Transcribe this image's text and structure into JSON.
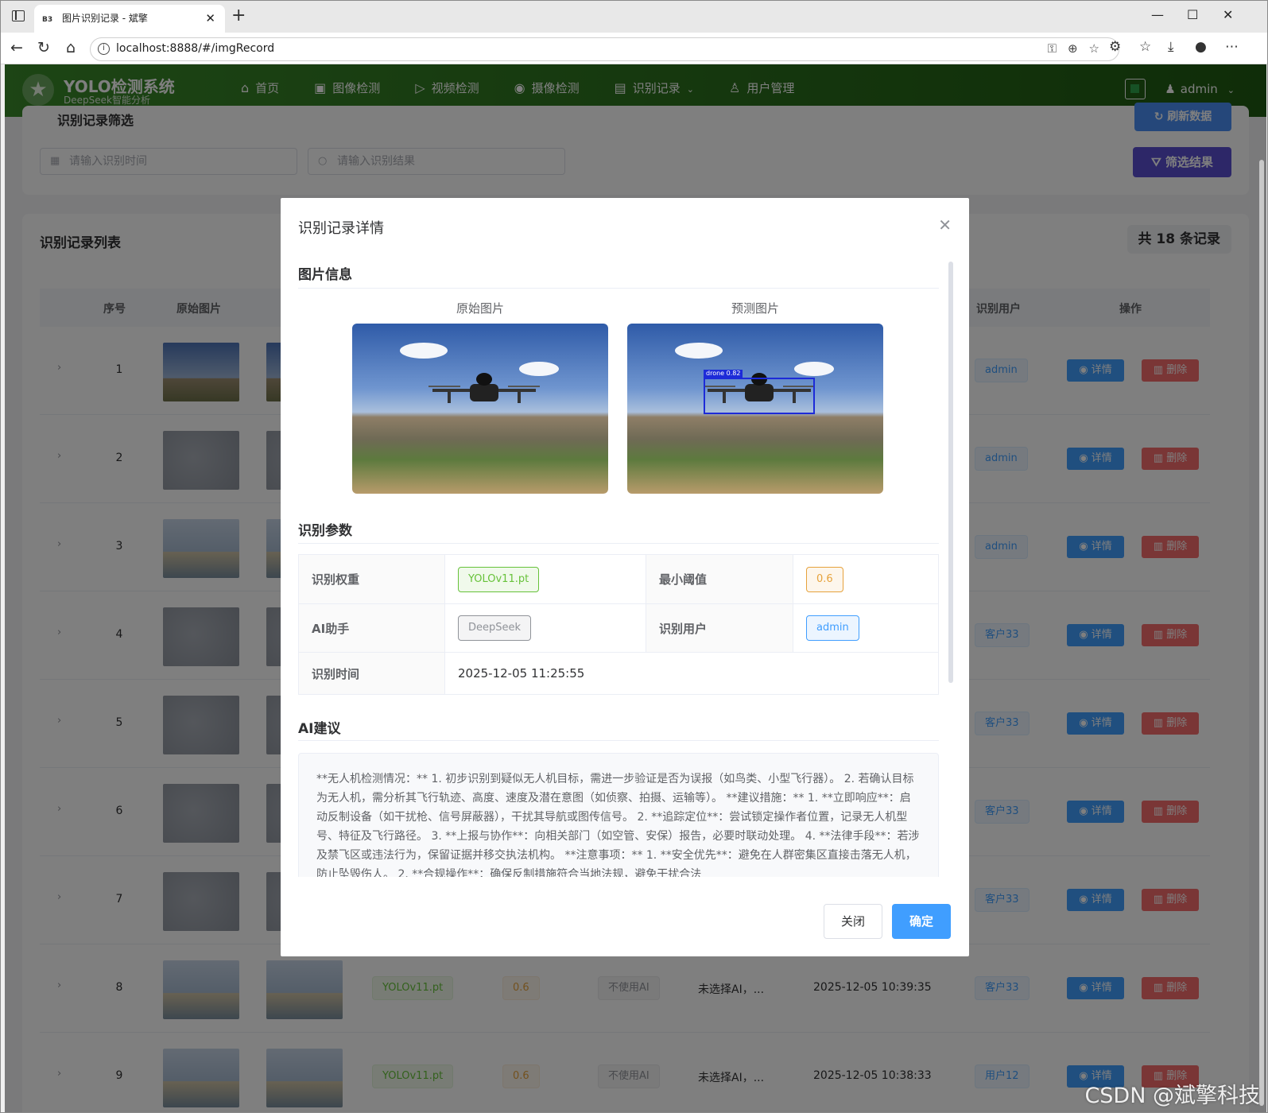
{
  "browser": {
    "tab_title": "图片识别记录 - 斌擎",
    "tab_favicon": "B3",
    "url": "localhost:8888/#/imgRecord"
  },
  "header": {
    "title": "YOLO检测系统",
    "subtitle": "DeepSeek智能分析",
    "nav": [
      {
        "label": "首页",
        "icon": "⌂"
      },
      {
        "label": "图像检测",
        "icon": "▣"
      },
      {
        "label": "视频检测",
        "icon": "▷"
      },
      {
        "label": "摄像检测",
        "icon": "◉"
      },
      {
        "label": "识别记录",
        "icon": "▤",
        "active": true
      },
      {
        "label": "用户管理",
        "icon": "♙"
      }
    ],
    "user": "admin"
  },
  "filter": {
    "title": "识别记录筛选",
    "time_placeholder": "请输入识别时间",
    "result_placeholder": "请输入识别结果",
    "refresh_label": "刷新数据",
    "filter_label": "筛选结果"
  },
  "list": {
    "title": "识别记录列表",
    "count_label": "共 18 条记录",
    "columns": {
      "index": "序号",
      "orig": "原始图片",
      "user": "识别用户",
      "ops": "操作"
    },
    "detail_label": "详情",
    "delete_label": "删除",
    "rows": [
      {
        "index": "1",
        "thumb": "sky",
        "user": "admin"
      },
      {
        "index": "2",
        "thumb": "grey",
        "user": "admin"
      },
      {
        "index": "3",
        "thumb": "beach",
        "user": "admin"
      },
      {
        "index": "4",
        "thumb": "grey",
        "user": "客户33"
      },
      {
        "index": "5",
        "thumb": "grey",
        "user": "客户33"
      },
      {
        "index": "6",
        "thumb": "grey",
        "user": "客户33"
      },
      {
        "index": "7",
        "thumb": "grey",
        "user": "客户33"
      },
      {
        "index": "8",
        "thumb": "beach",
        "user": "客户33",
        "weight": "YOLOv11.pt",
        "threshold": "0.6",
        "ai": "不使用AI",
        "result": "未选择AI，...",
        "time": "2025-12-05 10:39:35"
      },
      {
        "index": "9",
        "thumb": "beach",
        "user": "用户12",
        "weight": "YOLOv11.pt",
        "threshold": "0.6",
        "ai": "不使用AI",
        "result": "未选择AI，...",
        "time": "2025-12-05 10:38:33"
      }
    ]
  },
  "dialog": {
    "title": "识别记录详情",
    "image_section": "图片信息",
    "orig_label": "原始图片",
    "pred_label": "预测图片",
    "bbox_label": "drone 0.82",
    "params_section": "识别参数",
    "params": {
      "weight_label": "识别权重",
      "weight_value": "YOLOv11.pt",
      "threshold_label": "最小阈值",
      "threshold_value": "0.6",
      "ai_label": "AI助手",
      "ai_value": "DeepSeek",
      "user_label": "识别用户",
      "user_value": "admin",
      "time_label": "识别时间",
      "time_value": "2025-12-05 11:25:55"
    },
    "ai_section": "AI建议",
    "ai_text": "**无人机检测情况：** 1. 初步识别到疑似无人机目标，需进一步验证是否为误报（如鸟类、小型飞行器）。 2. 若确认目标为无人机，需分析其飞行轨迹、高度、速度及潜在意图（如侦察、拍摄、运输等）。 **建议措施：** 1. **立即响应**：启动反制设备（如干扰枪、信号屏蔽器），干扰其导航或图传信号。 2. **追踪定位**：尝试锁定操作者位置，记录无人机型号、特征及飞行路径。 3. **上报与协作**：向相关部门（如空管、安保）报告，必要时联动处理。 4. **法律手段**：若涉及禁飞区或违法行为，保留证据并移交执法机构。 **注意事项：** 1. **安全优先**：避免在人群密集区直接击落无人机，防止坠毁伤人。 2. **合规操作**：确保反制措施符合当地法规，避免干扰合法",
    "close_label": "关闭",
    "ok_label": "确定"
  },
  "watermark": "CSDN @斌擎科技",
  "colors": {
    "header_start": "#3a8a2a",
    "header_end": "#1f5a12",
    "primary": "#409eff",
    "danger": "#f56c6c",
    "filter_btn": "#5b4fd0"
  }
}
